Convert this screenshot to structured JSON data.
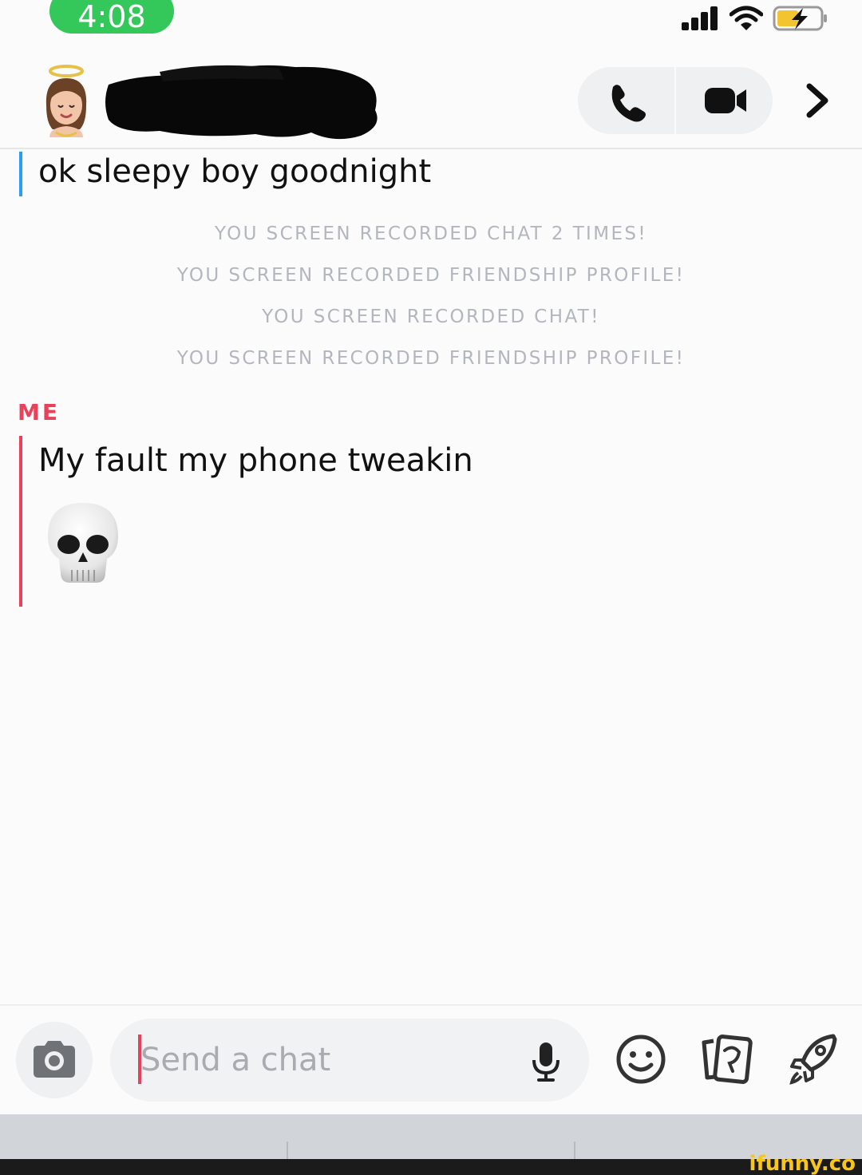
{
  "status_bar": {
    "time": "4:08",
    "signal_icon": "cellular-signal-icon",
    "wifi_icon": "wifi-icon",
    "battery_icon": "battery-charging-icon",
    "time_pill_color": "#34c759"
  },
  "header": {
    "avatar_icon": "bitmoji-avatar",
    "contact_name_redacted": true,
    "call_icon": "phone-icon",
    "video_icon": "video-camera-icon",
    "more_icon": "chevron-right-icon"
  },
  "chat": {
    "messages": [
      {
        "sender": "",
        "text": "ok sleepy boy goodnight",
        "accent": "#2a9df4"
      }
    ],
    "notices": [
      "YOU SCREEN RECORDED CHAT 2 TIMES!",
      "YOU SCREEN RECORDED FRIENDSHIP PROFILE!",
      "YOU SCREEN RECORDED CHAT!",
      "YOU SCREEN RECORDED FRIENDSHIP PROFILE!"
    ],
    "me": {
      "label": "ME",
      "text": "My fault my phone tweakin",
      "emoji": "skull-emoji",
      "accent": "#e8415a"
    }
  },
  "composer": {
    "placeholder": "Send a chat",
    "value": "",
    "camera_icon": "camera-icon",
    "mic_icon": "microphone-icon",
    "emoji_icon": "smiley-icon",
    "cards_icon": "stickers-cards-icon",
    "rocket_icon": "rocket-icon"
  },
  "watermark": "ifunny.co"
}
